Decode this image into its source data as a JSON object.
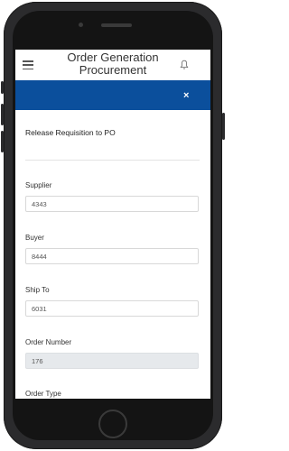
{
  "header": {
    "title": "Order Generation Procurement"
  },
  "modal": {
    "title": "Release Requisition to PO",
    "close_label": "×"
  },
  "fields": [
    {
      "label": "Supplier",
      "value": "4343"
    },
    {
      "label": "Buyer",
      "value": "8444"
    },
    {
      "label": "Ship To",
      "value": "6031"
    },
    {
      "label": "Order Number",
      "value": "176"
    },
    {
      "label": "Order Type",
      "value": ""
    }
  ],
  "icons": {
    "menu": "hamburger-menu-icon",
    "notifications": "bell-icon",
    "close": "close-icon"
  },
  "colors": {
    "modal_header": "#0b4f9c",
    "readonly_field": "#e6e9ec"
  }
}
